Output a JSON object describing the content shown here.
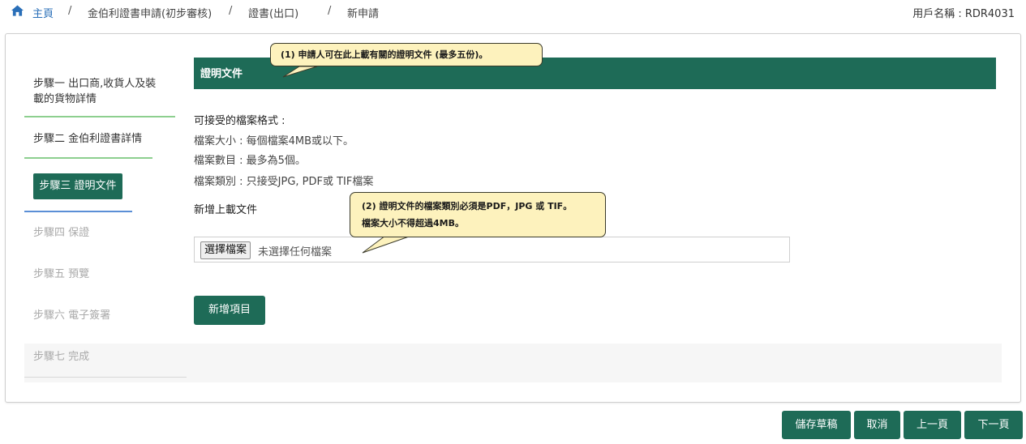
{
  "breadcrumb": {
    "home": "主頁",
    "separator": "/",
    "items": [
      "金伯利證書申請(初步審核)",
      "證書(出口)",
      "新申請"
    ]
  },
  "user": {
    "label": "用戶名稱 : RDR4031"
  },
  "steps": [
    {
      "line1": "步驟一 出口商,收貨人及裝",
      "line2": "載的貨物詳情"
    },
    {
      "label": "步驟二 金伯利證書詳情"
    },
    {
      "label": "步驟三 證明文件"
    },
    {
      "label": "步驟四 保證"
    },
    {
      "label": "步驟五 預覽"
    },
    {
      "label": "步驟六 電子簽署"
    },
    {
      "label": "步驟七 完成"
    }
  ],
  "section": {
    "title": "證明文件"
  },
  "formats": {
    "heading": "可接受的檔案格式 :",
    "size": "檔案大小 : 每個檔案4MB或以下。",
    "count": "檔案數目 : 最多為5個。",
    "type": "檔案類別 : 只接受JPG, PDF或 TIF檔案"
  },
  "upload": {
    "label": "新增上載文件",
    "button": "選擇檔案",
    "no_file": "未選擇任何檔案"
  },
  "add_item": "新增項目",
  "callouts": {
    "one": "(1) 申請人可在此上載有關的證明文件 (最多五份)。",
    "two_line1": "(2) 證明文件的檔案類別必須是PDF，JPG 或 TIF。",
    "two_line2": "檔案大小不得超過4MB。"
  },
  "actions": {
    "save_draft": "儲存草稿",
    "cancel": "取消",
    "prev": "上一頁",
    "next": "下一頁"
  },
  "colors": {
    "primary": "#1e6b57",
    "link": "#2a6fb8",
    "callout_bg": "#fdf2bd"
  }
}
